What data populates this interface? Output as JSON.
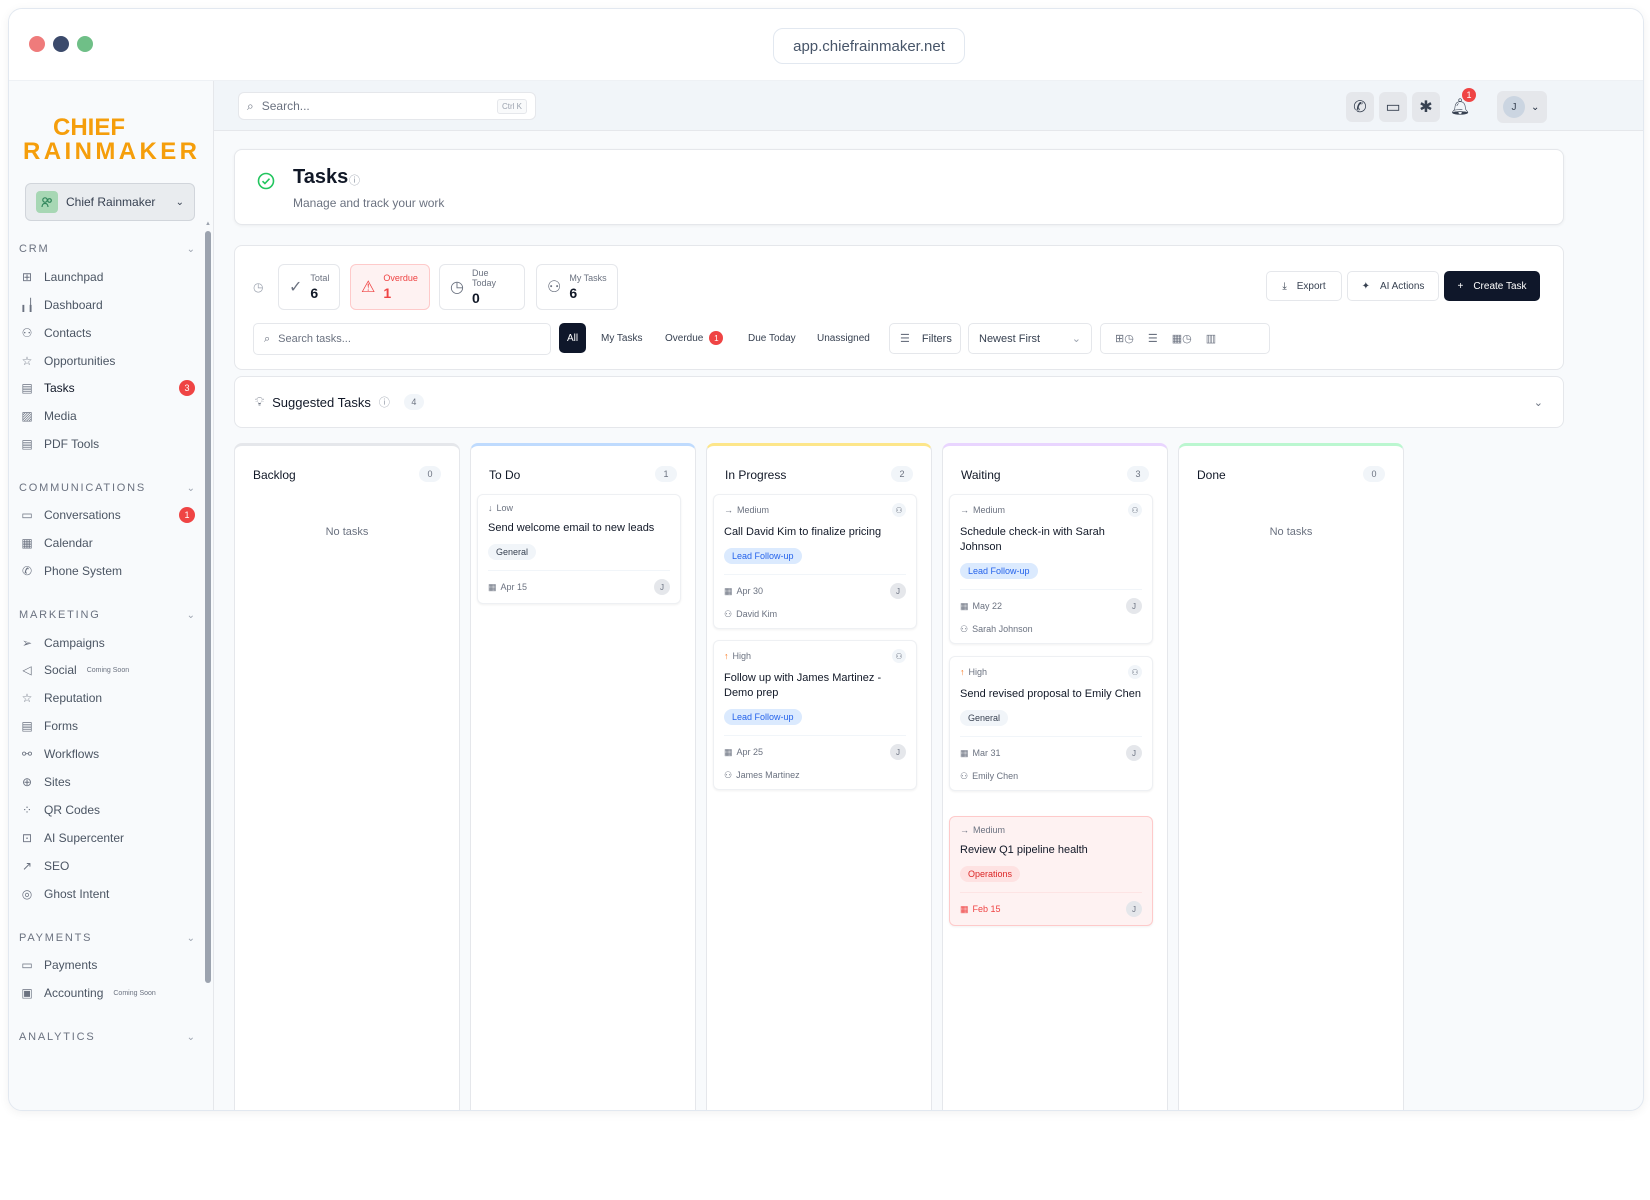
{
  "browser": {
    "url": "app.chiefrainmaker.net"
  },
  "brand": {
    "line1": "CHIEF",
    "line2": "RAINMAKER",
    "color": "#f59e0b"
  },
  "account": {
    "name": "Chief Rainmaker"
  },
  "topbar": {
    "search_placeholder": "Search...",
    "search_kbd": "Ctrl K",
    "notif_count": "1",
    "user_initial": "J"
  },
  "sidebar": {
    "crm": {
      "label": "CRM",
      "items": [
        {
          "label": "Launchpad",
          "icon": "grid-icon"
        },
        {
          "label": "Dashboard",
          "icon": "bar-chart-icon"
        },
        {
          "label": "Contacts",
          "icon": "users-icon"
        },
        {
          "label": "Opportunities",
          "icon": "star-icon"
        },
        {
          "label": "Tasks",
          "icon": "document-icon",
          "badge": "3"
        },
        {
          "label": "Media",
          "icon": "image-icon"
        },
        {
          "label": "PDF Tools",
          "icon": "pdf-icon"
        }
      ]
    },
    "communications": {
      "label": "COMMUNICATIONS",
      "items": [
        {
          "label": "Conversations",
          "icon": "chat-icon",
          "badge": "1"
        },
        {
          "label": "Calendar",
          "icon": "calendar-icon"
        },
        {
          "label": "Phone System",
          "icon": "phone-icon"
        }
      ]
    },
    "marketing": {
      "label": "MARKETING",
      "items": [
        {
          "label": "Campaigns",
          "icon": "send-icon"
        },
        {
          "label": "Social",
          "icon": "megaphone-icon",
          "soon": "Coming Soon"
        },
        {
          "label": "Reputation",
          "icon": "star-icon"
        },
        {
          "label": "Forms",
          "icon": "form-icon"
        },
        {
          "label": "Workflows",
          "icon": "workflow-icon"
        },
        {
          "label": "Sites",
          "icon": "globe-icon"
        },
        {
          "label": "QR Codes",
          "icon": "qr-icon"
        },
        {
          "label": "AI Supercenter",
          "icon": "robot-icon"
        },
        {
          "label": "SEO",
          "icon": "trend-icon"
        },
        {
          "label": "Ghost Intent",
          "icon": "eye-icon"
        }
      ]
    },
    "payments": {
      "label": "PAYMENTS",
      "items": [
        {
          "label": "Payments",
          "icon": "card-icon"
        },
        {
          "label": "Accounting",
          "icon": "ledger-icon",
          "soon": "Coming Soon"
        }
      ]
    },
    "analytics": {
      "label": "ANALYTICS"
    }
  },
  "header": {
    "title": "Tasks",
    "subtitle": "Manage and track your work"
  },
  "stats": [
    {
      "label": "Total",
      "value": "6"
    },
    {
      "label": "Overdue",
      "value": "1"
    },
    {
      "label": "Due Today",
      "value": "0"
    },
    {
      "label": "My Tasks",
      "value": "6"
    }
  ],
  "actions": {
    "export": "Export",
    "ai": "AI Actions",
    "create": "Create Task"
  },
  "filters": {
    "search_placeholder": "Search tasks...",
    "tabs": [
      "All",
      "My Tasks",
      "Overdue",
      "Due Today",
      "Unassigned"
    ],
    "overdue_badge": "1",
    "filters_label": "Filters",
    "sort": "Newest First"
  },
  "suggested": {
    "label": "Suggested Tasks",
    "count": "4"
  },
  "columns": [
    {
      "title": "Backlog",
      "count": "0",
      "empty": "No tasks",
      "color": "#e5e7eb"
    },
    {
      "title": "To Do",
      "count": "1",
      "color": "#bfdbfe"
    },
    {
      "title": "In Progress",
      "count": "2",
      "color": "#fde68a"
    },
    {
      "title": "Waiting",
      "count": "3",
      "color": "#e9d5ff"
    },
    {
      "title": "Done",
      "count": "0",
      "empty": "No tasks",
      "color": "#bbf7d0"
    }
  ],
  "cards": {
    "todo": [
      {
        "priority": "Low",
        "title": "Send welcome email to new leads",
        "tag": "General",
        "date": "Apr 15",
        "assignee_initial": "J"
      }
    ],
    "inprogress": [
      {
        "priority": "Medium",
        "title": "Call David Kim to finalize pricing",
        "tag": "Lead Follow-up",
        "date": "Apr 30",
        "assignee_initial": "J",
        "person": "David Kim"
      },
      {
        "priority": "High",
        "title": "Follow up with James Martinez - Demo prep",
        "tag": "Lead Follow-up",
        "date": "Apr 25",
        "assignee_initial": "J",
        "person": "James Martinez"
      }
    ],
    "waiting": [
      {
        "priority": "Medium",
        "title": "Schedule check-in with Sarah Johnson",
        "tag": "Lead Follow-up",
        "date": "May 22",
        "assignee_initial": "J",
        "person": "Sarah Johnson"
      },
      {
        "priority": "High",
        "title": "Send revised proposal to Emily Chen",
        "tag": "General",
        "date": "Mar 31",
        "assignee_initial": "J",
        "person": "Emily Chen"
      },
      {
        "priority": "Medium",
        "title": "Review Q1 pipeline health",
        "tag": "Operations",
        "date": "Feb 15",
        "assignee_initial": "J"
      }
    ]
  }
}
